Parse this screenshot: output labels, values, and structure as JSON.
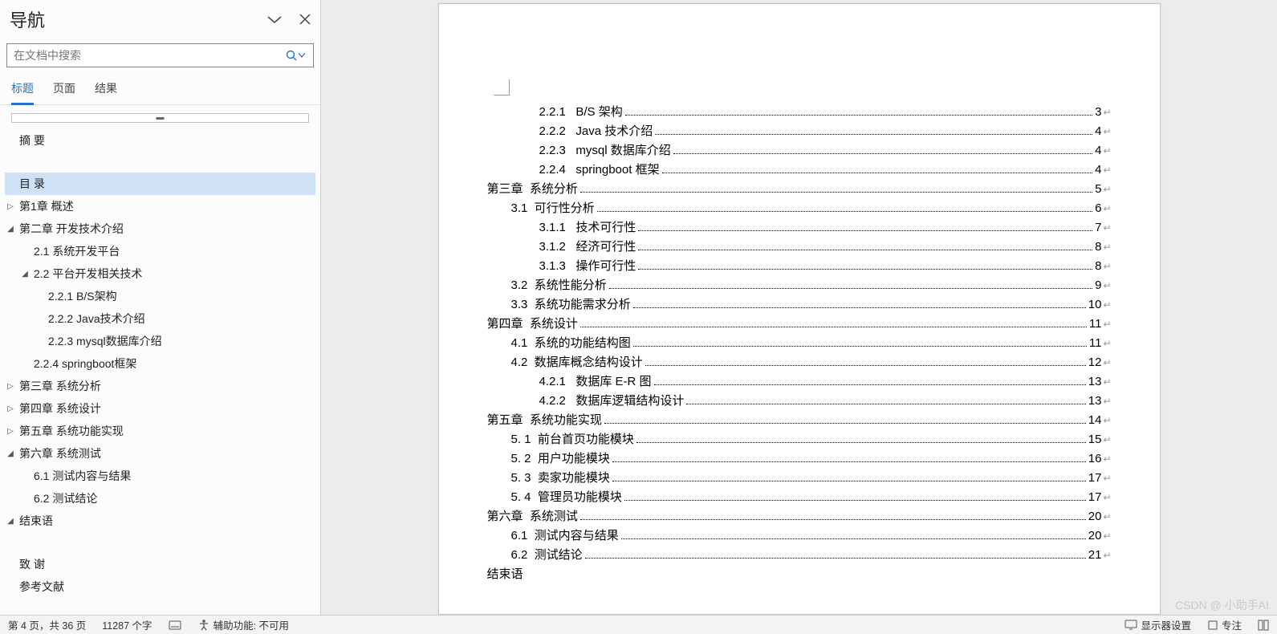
{
  "nav": {
    "title": "导航",
    "search_placeholder": "在文档中搜索",
    "tabs": [
      "标题",
      "页面",
      "结果"
    ],
    "active_tab": 0,
    "outline": [
      {
        "lvl": 1,
        "label": "摘 要",
        "caret": "none",
        "sel": false
      },
      {
        "lvl": 1,
        "label": "",
        "caret": "none",
        "sel": false,
        "blank": true
      },
      {
        "lvl": 1,
        "label": "目 录",
        "caret": "none",
        "sel": true
      },
      {
        "lvl": 1,
        "label": "第1章 概述",
        "caret": "right",
        "sel": false
      },
      {
        "lvl": 1,
        "label": "第二章 开发技术介绍",
        "caret": "down",
        "sel": false
      },
      {
        "lvl": 2,
        "label": "2.1 系统开发平台",
        "caret": "none",
        "sel": false
      },
      {
        "lvl": 2,
        "label": "2.2 平台开发相关技术",
        "caret": "down",
        "sel": false
      },
      {
        "lvl": 3,
        "label": "2.2.1 B/S架构",
        "caret": "none",
        "sel": false
      },
      {
        "lvl": 3,
        "label": "2.2.2 Java技术介绍",
        "caret": "none",
        "sel": false
      },
      {
        "lvl": 3,
        "label": "2.2.3 mysql数据库介绍",
        "caret": "none",
        "sel": false
      },
      {
        "lvl": 2,
        "label": "2.2.4 springboot框架",
        "caret": "none",
        "sel": false
      },
      {
        "lvl": 1,
        "label": "第三章 系统分析",
        "caret": "right",
        "sel": false
      },
      {
        "lvl": 1,
        "label": "第四章 系统设计",
        "caret": "right",
        "sel": false
      },
      {
        "lvl": 1,
        "label": "第五章 系统功能实现",
        "caret": "right",
        "sel": false
      },
      {
        "lvl": 1,
        "label": "第六章 系统测试",
        "caret": "down",
        "sel": false
      },
      {
        "lvl": 2,
        "label": "6.1 测试内容与结果",
        "caret": "none",
        "sel": false
      },
      {
        "lvl": 2,
        "label": "6.2 测试结论",
        "caret": "none",
        "sel": false
      },
      {
        "lvl": 1,
        "label": "结束语",
        "caret": "down",
        "sel": false
      },
      {
        "lvl": 1,
        "label": "",
        "caret": "none",
        "sel": false,
        "blank": true
      },
      {
        "lvl": 1,
        "label": "致  谢",
        "caret": "none",
        "sel": false
      },
      {
        "lvl": 1,
        "label": "参考文献",
        "caret": "none",
        "sel": false
      }
    ]
  },
  "toc": [
    {
      "lvl": 3,
      "num": "2.2.1",
      "text": "B/S 架构",
      "page": "3"
    },
    {
      "lvl": 3,
      "num": "2.2.2",
      "text": "Java 技术介绍",
      "page": "4"
    },
    {
      "lvl": 3,
      "num": "2.2.3",
      "text": "mysql 数据库介绍",
      "page": "4"
    },
    {
      "lvl": 3,
      "num": "2.2.4",
      "text": "springboot 框架",
      "page": "4"
    },
    {
      "lvl": 1,
      "num": "第三章",
      "text": "系统分析",
      "page": "5"
    },
    {
      "lvl": 2,
      "num": "3.1",
      "text": "可行性分析",
      "page": "6"
    },
    {
      "lvl": 3,
      "num": "3.1.1",
      "text": "技术可行性",
      "page": "7"
    },
    {
      "lvl": 3,
      "num": "3.1.2",
      "text": "经济可行性",
      "page": "8"
    },
    {
      "lvl": 3,
      "num": "3.1.3",
      "text": "操作可行性",
      "page": "8"
    },
    {
      "lvl": 2,
      "num": "3.2",
      "text": "系统性能分析",
      "page": "9"
    },
    {
      "lvl": 2,
      "num": "3.3",
      "text": "系统功能需求分析",
      "page": "10"
    },
    {
      "lvl": 1,
      "num": "第四章",
      "text": "系统设计",
      "page": "11"
    },
    {
      "lvl": 2,
      "num": "4.1",
      "text": "系统的功能结构图",
      "page": "11"
    },
    {
      "lvl": 2,
      "num": "4.2",
      "text": "数据库概念结构设计",
      "page": "12"
    },
    {
      "lvl": 3,
      "num": "4.2.1",
      "text": "数据库 E-R 图",
      "page": "13"
    },
    {
      "lvl": 3,
      "num": "4.2.2",
      "text": "数据库逻辑结构设计",
      "page": "13"
    },
    {
      "lvl": 1,
      "num": "第五章",
      "text": "系统功能实现",
      "page": "14"
    },
    {
      "lvl": 2,
      "num": "5. 1",
      "text": "前台首页功能模块",
      "page": "15"
    },
    {
      "lvl": 2,
      "num": "5. 2",
      "text": "用户功能模块",
      "page": "16"
    },
    {
      "lvl": 2,
      "num": "5. 3",
      "text": "卖家功能模块",
      "page": "17"
    },
    {
      "lvl": 2,
      "num": "5. 4",
      "text": "管理员功能模块",
      "page": "17"
    },
    {
      "lvl": 1,
      "num": "第六章",
      "text": "系统测试",
      "page": "20"
    },
    {
      "lvl": 2,
      "num": "6.1",
      "text": "测试内容与结果",
      "page": "20"
    },
    {
      "lvl": 2,
      "num": "6.2",
      "text": "测试结论",
      "page": "21"
    }
  ],
  "toc_tail": "结束语",
  "status": {
    "page": "第 4 页，共 36 页",
    "words": "11287 个字",
    "access": "辅助功能: 不可用",
    "display": "显示器设置",
    "focus": "专注"
  },
  "watermark": "CSDN @ 小助手AI"
}
